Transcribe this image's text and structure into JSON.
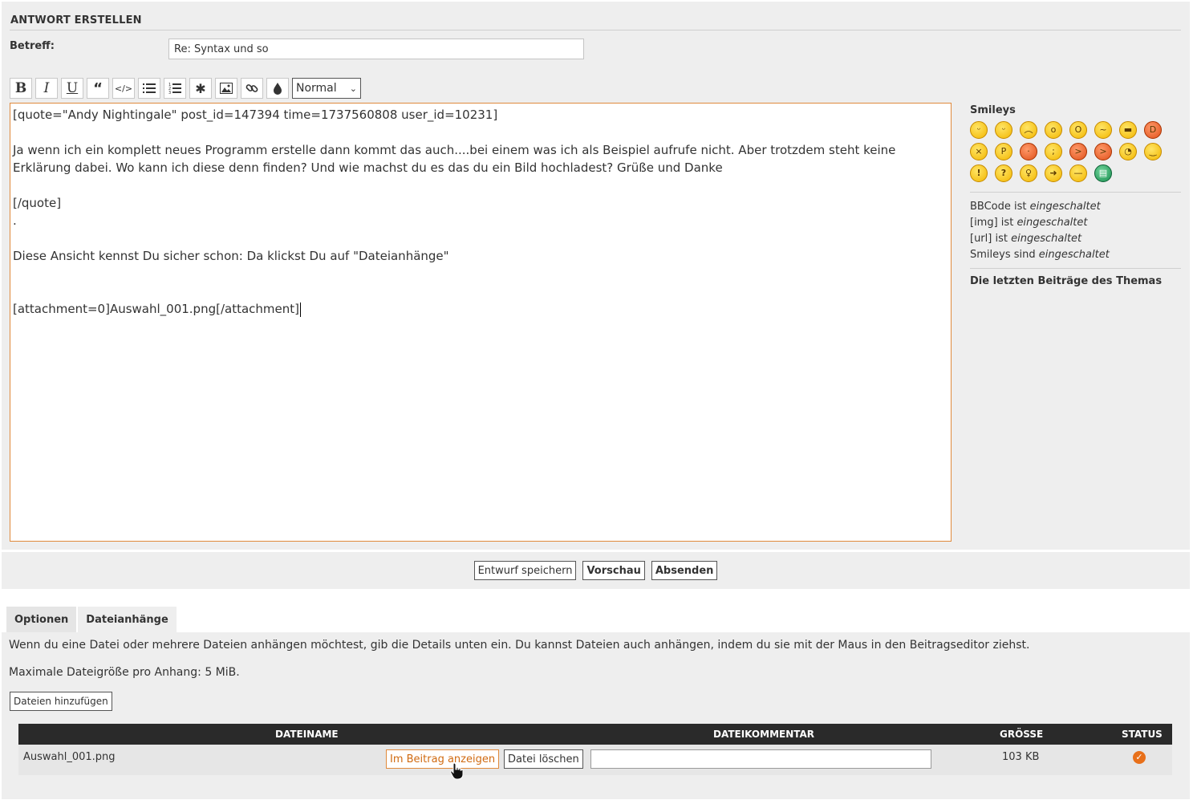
{
  "panel": {
    "title": "ANTWORT ERSTELLEN"
  },
  "subject": {
    "label": "Betreff:",
    "value": "Re: Syntax und so"
  },
  "toolbar": {
    "buttons": [
      "B",
      "I",
      "U",
      "❝",
      "</>",
      "☰",
      "≡",
      "✱",
      "▣",
      "🔗",
      "💧"
    ],
    "font_size": "Normal"
  },
  "editor": {
    "lines": [
      "[quote=\"Andy Nightingale\" post_id=147394 time=1737560808 user_id=10231]",
      "",
      "Ja wenn ich ein komplett neues Programm erstelle dann kommt das auch....bei einem was ich als Beispiel aufrufe nicht. Aber trotzdem steht keine",
      "Erklärung dabei. Wo kann ich diese denn finden? Und wie machst du es das du ein Bild hochladest? Grüße und Danke",
      "",
      "[/quote]",
      ".",
      "",
      "Diese Ansicht kennst Du sicher schon: Da klickst Du auf \"Dateianhänge\"",
      "",
      "",
      "[attachment=0]Auswahl_001.png[/attachment]"
    ]
  },
  "sidebar": {
    "smileys_title": "Smileys",
    "smileys": [
      "grin-icon",
      "laugh-icon",
      "sad-icon",
      "surprised-icon",
      "shocked-icon",
      "confused-icon",
      "cool-icon",
      "lol-icon",
      "mad-icon",
      "razz-icon",
      "redface-icon",
      "cry-icon",
      "evil-icon",
      "twisted-icon",
      "rolleyes-icon",
      "smile-icon",
      "exclaim-icon",
      "question-icon",
      "idea-icon",
      "arrow-icon",
      "neutral-icon",
      "mrgreen-icon"
    ],
    "status": [
      {
        "label": "BBCode ist",
        "value": "eingeschaltet"
      },
      {
        "label": "[img] ist",
        "value": "eingeschaltet"
      },
      {
        "label": "[url] ist",
        "value": "eingeschaltet"
      },
      {
        "label": "Smileys sind",
        "value": "eingeschaltet"
      }
    ],
    "recent_title": "Die letzten Beiträge des Themas"
  },
  "actions": {
    "save_draft": "Entwurf speichern",
    "preview": "Vorschau",
    "submit": "Absenden"
  },
  "tabs": [
    {
      "label": "Optionen",
      "active": false
    },
    {
      "label": "Dateianhänge",
      "active": true
    }
  ],
  "attachments": {
    "intro": "Wenn du eine Datei oder mehrere Dateien anhängen möchtest, gib die Details unten ein. Du kannst Dateien auch anhängen, indem du sie mit der Maus in den Beitragseditor ziehst.",
    "max_size": "Maximale Dateigröße pro Anhang: 5 MiB.",
    "add_button": "Dateien hinzufügen",
    "columns": [
      "DATEINAME",
      "DATEIKOMMENTAR",
      "GRÖSSE",
      "STATUS"
    ],
    "rows": [
      {
        "filename": "Auswahl_001.png",
        "show_button": "Im Beitrag anzeigen",
        "delete_button": "Datei löschen",
        "comment": "",
        "size": "103 KB",
        "status": "ok"
      }
    ]
  }
}
